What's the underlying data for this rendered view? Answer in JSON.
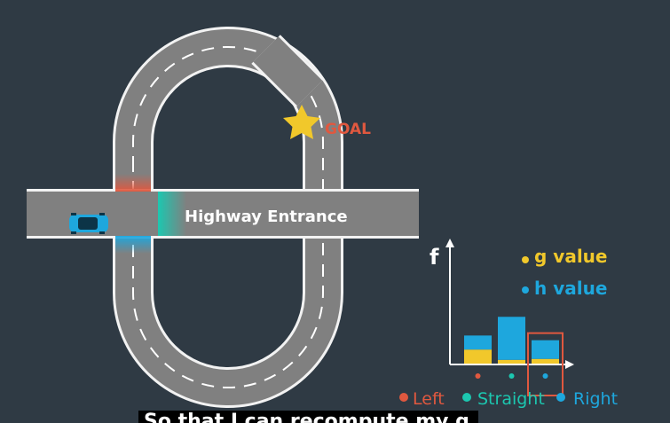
{
  "scene": {
    "goal_label": "GOAL",
    "highway_label": "Highway Entrance",
    "colors": {
      "background": "#2f3a44",
      "road": "#808080",
      "road_edge": "#f2f2f2",
      "lane_dash": "#ffffff",
      "left_marker": "#e0583f",
      "straight_marker": "#1cc7b0",
      "right_marker": "#1ea7dd",
      "star": "#f1c82b",
      "goal_text": "#e0583f"
    }
  },
  "chart": {
    "f_label": "f",
    "legend": [
      {
        "text": "g value",
        "color": "#f1c82b"
      },
      {
        "text": "h value",
        "color": "#1ea7dd"
      }
    ],
    "bottom_legend": [
      {
        "text": "Left",
        "color": "#e0583f"
      },
      {
        "text": "Straight",
        "color": "#1cc7b0"
      },
      {
        "text": "Right",
        "color": "#1ea7dd"
      }
    ]
  },
  "chart_data": {
    "type": "bar",
    "stacked": true,
    "categories": [
      "Left",
      "Straight",
      "Right"
    ],
    "series": [
      {
        "name": "g value",
        "values": [
          1.5,
          0.4,
          0.5
        ]
      },
      {
        "name": "h value",
        "values": [
          1.5,
          4.6,
          2.0
        ]
      }
    ],
    "selected_category": "Right",
    "title": "",
    "xlabel": "",
    "ylabel": "f",
    "ylim": [
      0,
      5.5
    ]
  },
  "subtitle": {
    "text": "So that I can recompute my g"
  }
}
